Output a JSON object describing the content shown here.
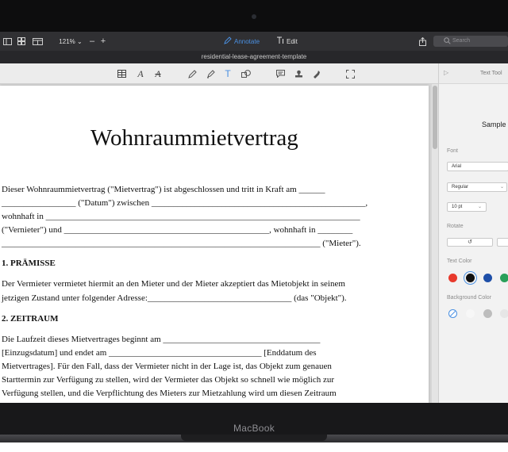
{
  "toolbar": {
    "zoom": "121% ⌄",
    "annotate_label": "Annotate",
    "edit_label": "Edit",
    "search_placeholder": "Search",
    "accent": "#4a90e2"
  },
  "window": {
    "file_title": "residential-lease-agreement-template"
  },
  "annotation_tools": [
    "table-icon",
    "text-A-icon",
    "text-A-italic-icon",
    "pencil-icon",
    "highlighter-icon",
    "text-T-icon",
    "shapes-icon",
    "comment-icon",
    "stamp-icon",
    "signature-pen-icon",
    "fit-screen-icon"
  ],
  "document": {
    "title": "Wohnraummietvertrag",
    "lines": [
      "Dieser Wohnraummietvertrag (\"Mietvertrag\") ist abgeschlossen und tritt in Kraft am  ______",
      "_________________ (\"Datum\") zwischen _________________________________________________,",
      "wohnhaft in ________________________________________________________________________",
      "(\"Vernieter\") und _______________________________________________, wohnhaft in ________",
      "_________________________________________________________________________ (\"Mieter\").",
      "Der Vermieter vermietet hiermit an den Mieter und der Mieter akzeptiert das Mietobjekt in seinem",
      "jetzigen Zustand unter folgender Adresse:_________________________________ (das \"Objekt\").",
      "Die Laufzeit dieses Mietvertrages beginnt am ____________________________________",
      "[Einzugsdatum] und endet am ___________________________________ [Enddatum des",
      "Mietvertrages]. Für den Fall, dass der Vermieter nicht in der Lage ist, das Objekt zum genauen",
      "Starttermin zur Verfügung zu stellen, wird der Vermieter das Objekt so schnell wie möglich zur",
      "Verfügung stellen, und die Verpflichtung des Mieters zur Mietzahlung wird um diesen Zeitraum"
    ],
    "heading_1": "1. PRÄMISSE",
    "heading_2": "2. ZEITRAUM"
  },
  "panel": {
    "title": "Text Tool",
    "sample": "Sample",
    "font_label": "Font",
    "font_value": "Arial",
    "style_value": "Regular",
    "size_value": "10 pt",
    "rotate_label": "Rotate",
    "text_color_label": "Text Color",
    "text_colors": [
      "#e8392c",
      "#111111",
      "#1e4fa8",
      "#2aa05a"
    ],
    "background_color_label": "Background Color",
    "background_colors": [
      "none",
      "#f7f7f7",
      "#bdbdbd",
      "#e6e6e6"
    ]
  },
  "device": {
    "brand": "MacBook"
  }
}
